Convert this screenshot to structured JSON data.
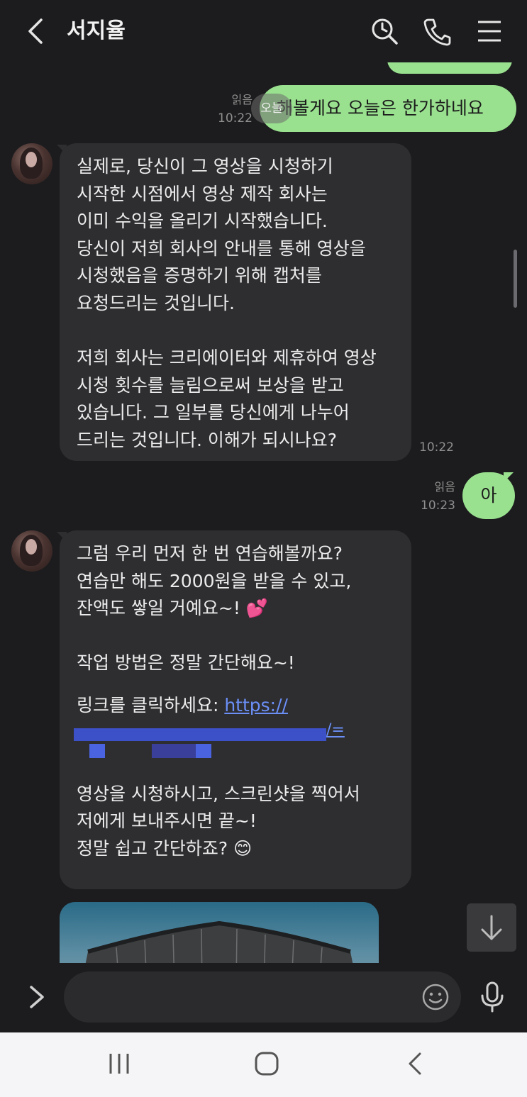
{
  "header": {
    "title": "서지율",
    "icons": [
      "back-arrow-icon",
      "search-icon",
      "phone-icon",
      "menu-icon"
    ]
  },
  "messages": [
    {
      "id": "m1",
      "side": "out",
      "text": "해볼게요 오늘은 한가하네요",
      "read": "읽음",
      "time": "10:22",
      "overlay_text": "오늘"
    },
    {
      "id": "m2",
      "side": "in",
      "text": "실제로, 당신이 그 영상을 시청하기\n시작한 시점에서 영상 제작 회사는\n이미 수익을 올리기 시작했습니다.\n당신이 저희 회사의 안내를 통해 영상을\n시청했음을 증명하기 위해 캡처를\n요청드리는 것입니다.\n\n저희 회사는 크리에이터와 제휴하여 영상\n시청 횟수를 늘림으로써 보상을 받고\n있습니다. 그 일부를 당신에게 나누어\n드리는 것입니다. 이해가 되시나요?",
      "time": "10:22"
    },
    {
      "id": "m3",
      "side": "out",
      "text": "아",
      "read": "읽음",
      "time": "10:23"
    },
    {
      "id": "m4",
      "side": "in",
      "text_1": "그럼 우리 먼저 한 번 연습해볼까요?\n연습만 해도 2000원을 받을 수 있고,\n잔액도 쌓일 거예요~! 💕\n\n작업 방법은 정말 간단해요~!",
      "link_prefix": "링크를 클릭하세요: ",
      "link_text": "https://",
      "link_tail": "/=",
      "text_2": "영상을 시청하시고, 스크린샷을 찍어서\n저에게 보내주시면 끝~!\n정말 쉽고 간단하죠? 😊"
    }
  ],
  "input": {
    "placeholder": "",
    "icons": [
      "expand-arrow-icon",
      "emoji-icon",
      "mic-icon"
    ]
  },
  "scroll_button_icon": "arrow-down-icon",
  "navbar": {
    "icons": [
      "recent-apps-icon",
      "home-icon",
      "back-icon"
    ]
  },
  "colors": {
    "outgoing_bubble": "#99e18f",
    "incoming_bubble": "#2e2e31",
    "background": "#1c1c1e",
    "link": "#6b8ff7"
  }
}
